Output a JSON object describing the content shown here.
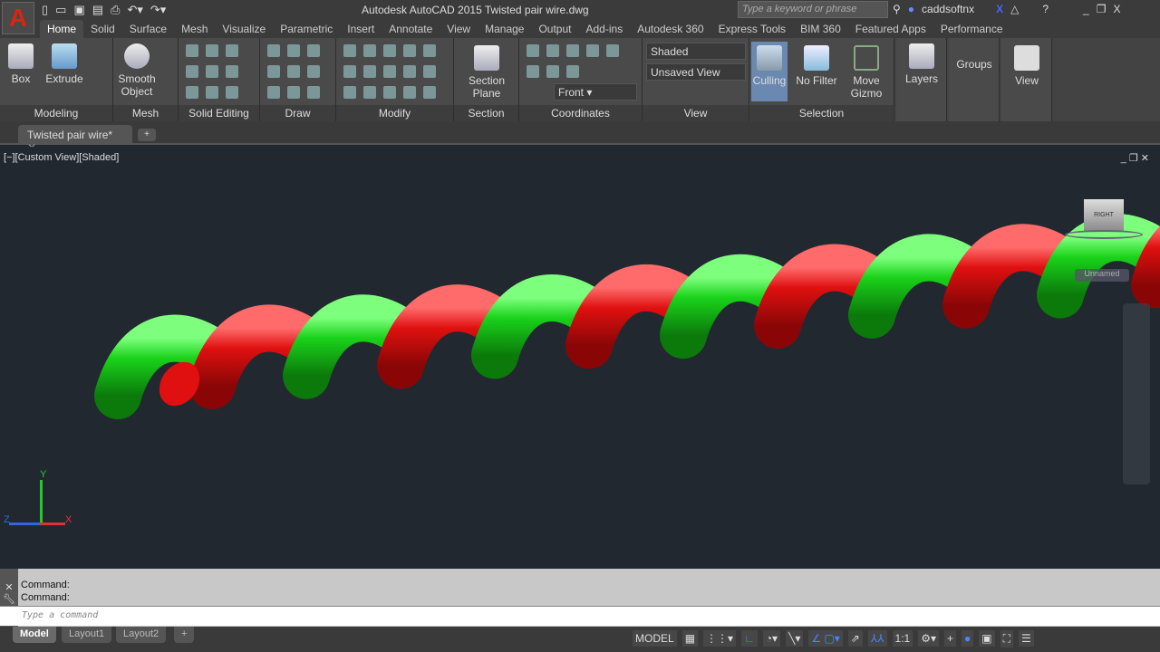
{
  "app": {
    "title": "Autodesk AutoCAD 2015   Twisted pair wire.dwg",
    "logo": "A",
    "search_placeholder": "Type a keyword or phrase",
    "user": "caddsoftnx"
  },
  "qat": [
    "new-icon",
    "open-icon",
    "save-icon",
    "saveas-icon",
    "plot-icon",
    "undo-icon",
    "redo-icon"
  ],
  "tabs": [
    "Home",
    "Solid",
    "Surface",
    "Mesh",
    "Visualize",
    "Parametric",
    "Insert",
    "Annotate",
    "View",
    "Manage",
    "Output",
    "Add-ins",
    "Autodesk 360",
    "Express Tools",
    "BIM 360",
    "Featured Apps",
    "Performance"
  ],
  "ribbon": {
    "modeling": {
      "title": "Modeling",
      "box": "Box",
      "extrude": "Extrude"
    },
    "mesh": {
      "title": "Mesh",
      "smooth": "Smooth Object"
    },
    "solid_editing": {
      "title": "Solid Editing"
    },
    "draw": {
      "title": "Draw"
    },
    "modify": {
      "title": "Modify"
    },
    "section": {
      "title": "Section",
      "plane": "Section Plane"
    },
    "coordinates": {
      "title": "Coordinates",
      "ucs_view": "Front"
    },
    "view": {
      "title": "View",
      "visual_style": "Shaded",
      "named_view": "Unsaved View"
    },
    "selection": {
      "title": "Selection",
      "culling": "Culling",
      "filter": "No Filter",
      "gizmo": "Move Gizmo"
    },
    "layers": "Layers",
    "groups": "Groups",
    "view_panel": "View"
  },
  "document_tab": "Twisted pair wire*",
  "viewport": {
    "label": "[−][Custom View][Shaded]",
    "viewcube_face": "RIGHT",
    "ucs_name": "Unnamed",
    "axes": {
      "x": "X",
      "y": "Y",
      "z": "Z"
    },
    "colors": {
      "wire1": "#e01010",
      "wire2": "#1ad21a"
    }
  },
  "command": {
    "history": [
      "Command:",
      "Command:"
    ],
    "placeholder": "Type a command"
  },
  "layouts": [
    "Model",
    "Layout1",
    "Layout2"
  ],
  "status": {
    "model": "MODEL",
    "scale": "1:1"
  }
}
